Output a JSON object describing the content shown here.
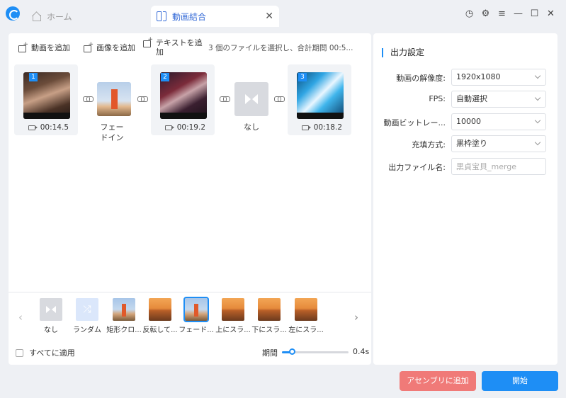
{
  "app": {
    "tabs": [
      {
        "label": "ホーム"
      },
      {
        "label": "動画結合"
      }
    ]
  },
  "toolbar": {
    "add_video": "動画を追加",
    "add_image": "画像を追加",
    "add_text": "テキストを追加",
    "info": "3 個のファイルを選択し、合計期間 00:5..."
  },
  "timeline": {
    "clips": [
      {
        "index": "1",
        "duration": "00:14.5"
      },
      {
        "index": "2",
        "duration": "00:19.2"
      },
      {
        "index": "3",
        "duration": "00:18.2"
      }
    ],
    "transitions": [
      {
        "label": "フェードイン"
      },
      {
        "label": "なし"
      }
    ]
  },
  "effects": {
    "items": [
      {
        "label": "なし"
      },
      {
        "label": "ランダム"
      },
      {
        "label": "矩形クロ..."
      },
      {
        "label": "反転して..."
      },
      {
        "label": "フェード..."
      },
      {
        "label": "上にスラ..."
      },
      {
        "label": "下にスラ..."
      },
      {
        "label": "左にスラ..."
      }
    ],
    "apply_all": "すべてに適用",
    "period_label": "期間",
    "period_value": "0.4s",
    "period_fraction": 0.15
  },
  "output": {
    "title": "出力設定",
    "resolution_label": "動画の解像度:",
    "resolution_value": "1920x1080",
    "fps_label": "FPS:",
    "fps_value": "自動選択",
    "bitrate_label": "動画ビットレー...",
    "bitrate_value": "10000",
    "fill_label": "充填方式:",
    "fill_value": "黒枠塗り",
    "filename_label": "出力ファイル名:",
    "filename_placeholder": "黒貞宝貝_merge"
  },
  "actions": {
    "add_to_assembly": "アセンブリに追加",
    "start": "開始"
  },
  "colors": {
    "accent": "#1e8ef5",
    "add_button": "#f07a78"
  }
}
